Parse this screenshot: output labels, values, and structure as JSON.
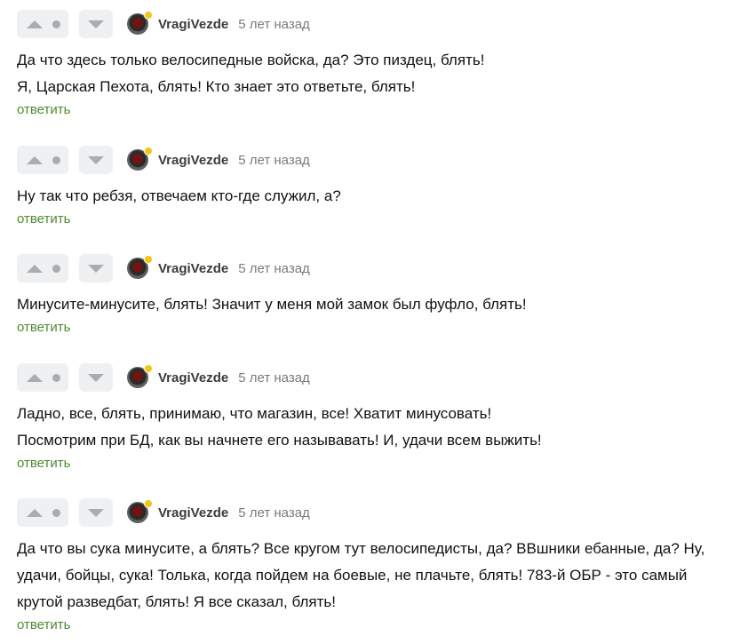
{
  "comments": [
    {
      "username": "VragiVezde",
      "time": "5 лет назад",
      "lines": [
        "Да что здесь только велосипедные войска, да? Это пиздец, блять!",
        "Я, Царская Пехота, блять! Кто знает это ответьте, блять!"
      ],
      "reply_label": "ответить"
    },
    {
      "username": "VragiVezde",
      "time": "5 лет назад",
      "lines": [
        "Ну так что ребзя, отвечаем кто-где служил, а?"
      ],
      "reply_label": "ответить"
    },
    {
      "username": "VragiVezde",
      "time": "5 лет назад",
      "lines": [
        "Минусите-минусите, блять! Значит у меня мой замок был фуфло, блять!"
      ],
      "reply_label": "ответить"
    },
    {
      "username": "VragiVezde",
      "time": "5 лет назад",
      "lines": [
        "Ладно, все, блять, принимаю, что магазин, все! Хватит минусовать!",
        "Посмотрим при БД, как вы начнете его называвать! И, удачи всем выжить!"
      ],
      "reply_label": "ответить"
    },
    {
      "username": "VragiVezde",
      "time": "5 лет назад",
      "lines": [
        "Да что вы сука минусите, а блять? Все кругом тут велосипедисты, да? ВВшники ебанные, да? Ну,",
        "удачи, бойцы, сука! Толька, когда пойдем на боевые, не плачьте, блять! 783-й ОБР - это самый",
        "крутой разведбат, блять! Я все сказал, блять!"
      ],
      "reply_label": "ответить"
    }
  ],
  "colors": {
    "accent_reply": "#4f8a2f",
    "online_indicator": "#f5c518",
    "vote_background": "#eef0f2",
    "vote_icon": "#a7adb3"
  },
  "icons": {
    "vote_up": "triangle-up-icon",
    "vote_down": "triangle-down-icon",
    "rating_dot": "dot-icon",
    "avatar": "user-avatar",
    "online": "online-indicator-icon"
  }
}
